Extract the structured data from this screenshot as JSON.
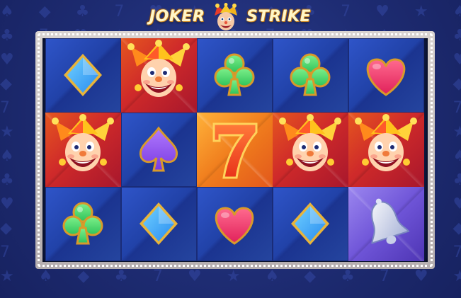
{
  "game": {
    "title_left": "JOKER",
    "title_right": "STRIKE"
  },
  "reels": {
    "columns": 5,
    "rows": 3,
    "grid": [
      [
        "diamond",
        "joker",
        "club",
        "club",
        "heart"
      ],
      [
        "joker",
        "spade",
        "seven",
        "joker",
        "joker"
      ],
      [
        "club",
        "diamond",
        "heart",
        "diamond",
        "bell"
      ]
    ],
    "cell_backgrounds": [
      [
        "blue",
        "red",
        "blue",
        "blue",
        "blue"
      ],
      [
        "red",
        "blue",
        "orange",
        "red",
        "red"
      ],
      [
        "blue",
        "blue",
        "blue",
        "blue",
        "purple"
      ]
    ]
  },
  "symbol_names": {
    "diamond": "diamond-symbol-icon",
    "joker": "joker-symbol-icon",
    "club": "club-symbol-icon",
    "heart": "heart-symbol-icon",
    "spade": "spade-symbol-icon",
    "seven": "seven-symbol-icon",
    "bell": "bell-symbol-icon"
  },
  "colors": {
    "background": "#1e2c73",
    "frame": "#c9c3c4",
    "diamond": "#2a8cf0",
    "club": "#2ec25a",
    "heart": "#e0205a",
    "spade": "#7a3ae0",
    "seven": "#e8321a"
  }
}
